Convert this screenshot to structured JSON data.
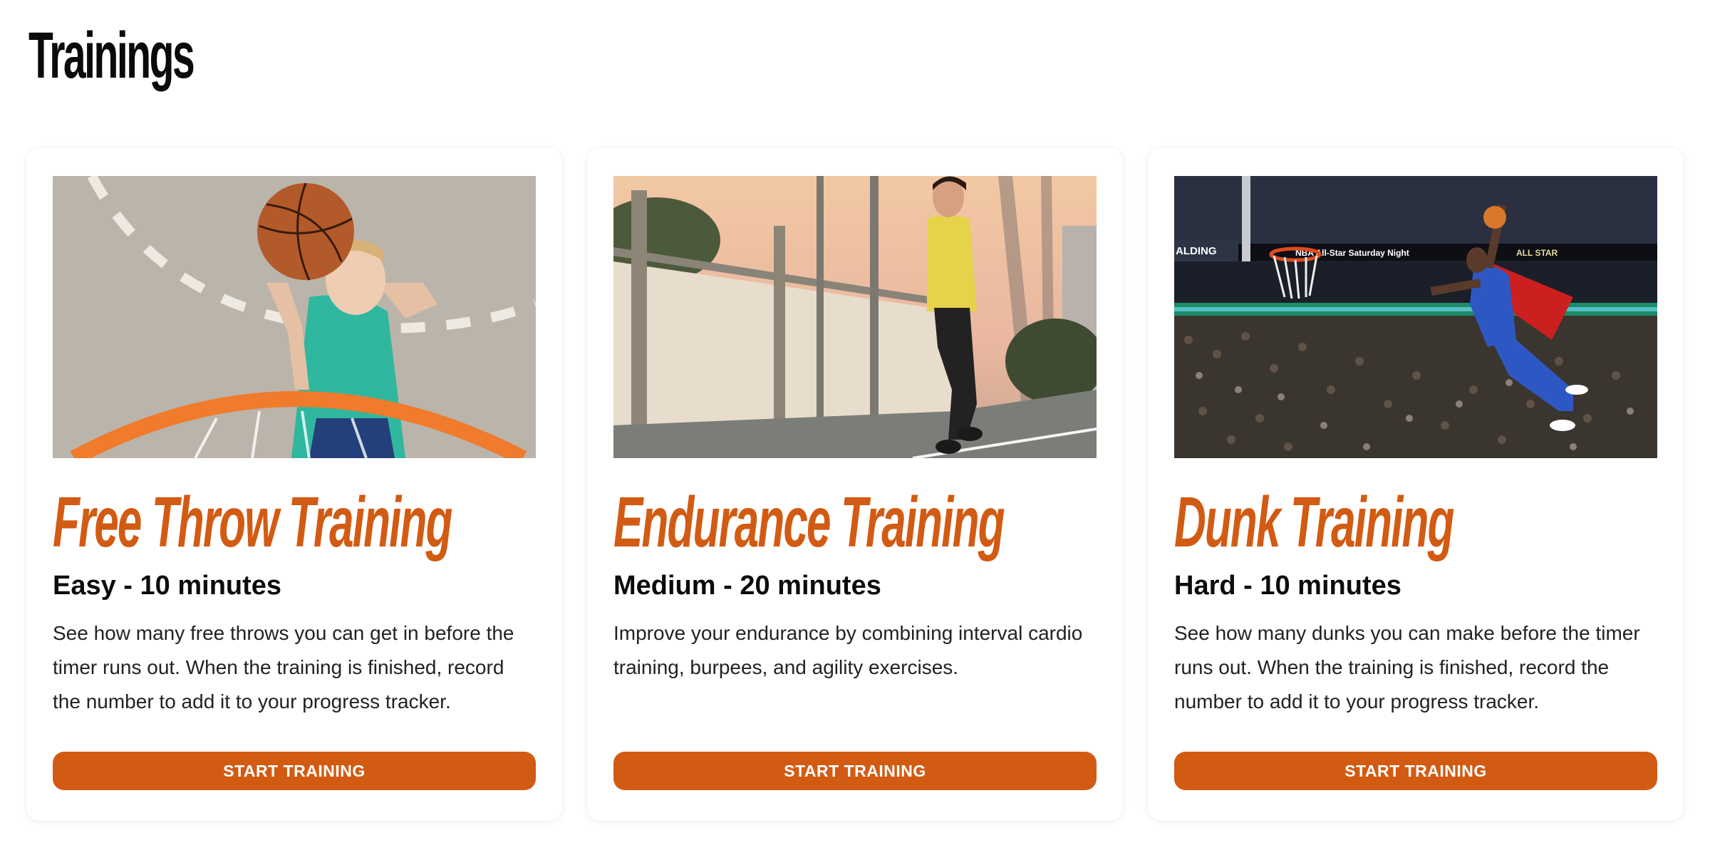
{
  "page": {
    "title": "Trainings"
  },
  "colors": {
    "accent": "#d25b13",
    "text": "#111111",
    "background": "#ffffff"
  },
  "cards": [
    {
      "title": "Free Throw Training",
      "meta": "Easy - 10 minutes",
      "description": "See how many free throws you can get in before the timer runs out. When the training is finished, record the number to add it to your progress tracker.",
      "button_label": "START TRAINING",
      "image": "photo of a child shooting a basketball toward a hoop"
    },
    {
      "title": "Endurance Training",
      "meta": "Medium - 20 minutes",
      "description": "Improve your endurance by combining interval cardio training, burpees, and agility exercises.",
      "button_label": "START TRAINING",
      "image": "photo of a woman jogging along a fence at sunset"
    },
    {
      "title": "Dunk Training",
      "meta": "Hard - 10 minutes",
      "description": "See how many dunks you can make before the timer runs out. When the training is finished, record the number to add it to your progress tracker.",
      "button_label": "START TRAINING",
      "image": "photo of a basketball player in a superhero cape dunking in an arena",
      "image_text": {
        "left_sign": "ALDING",
        "banner": "NBA All-Star Saturday Night",
        "right_sign": "ALL STAR"
      }
    }
  ]
}
